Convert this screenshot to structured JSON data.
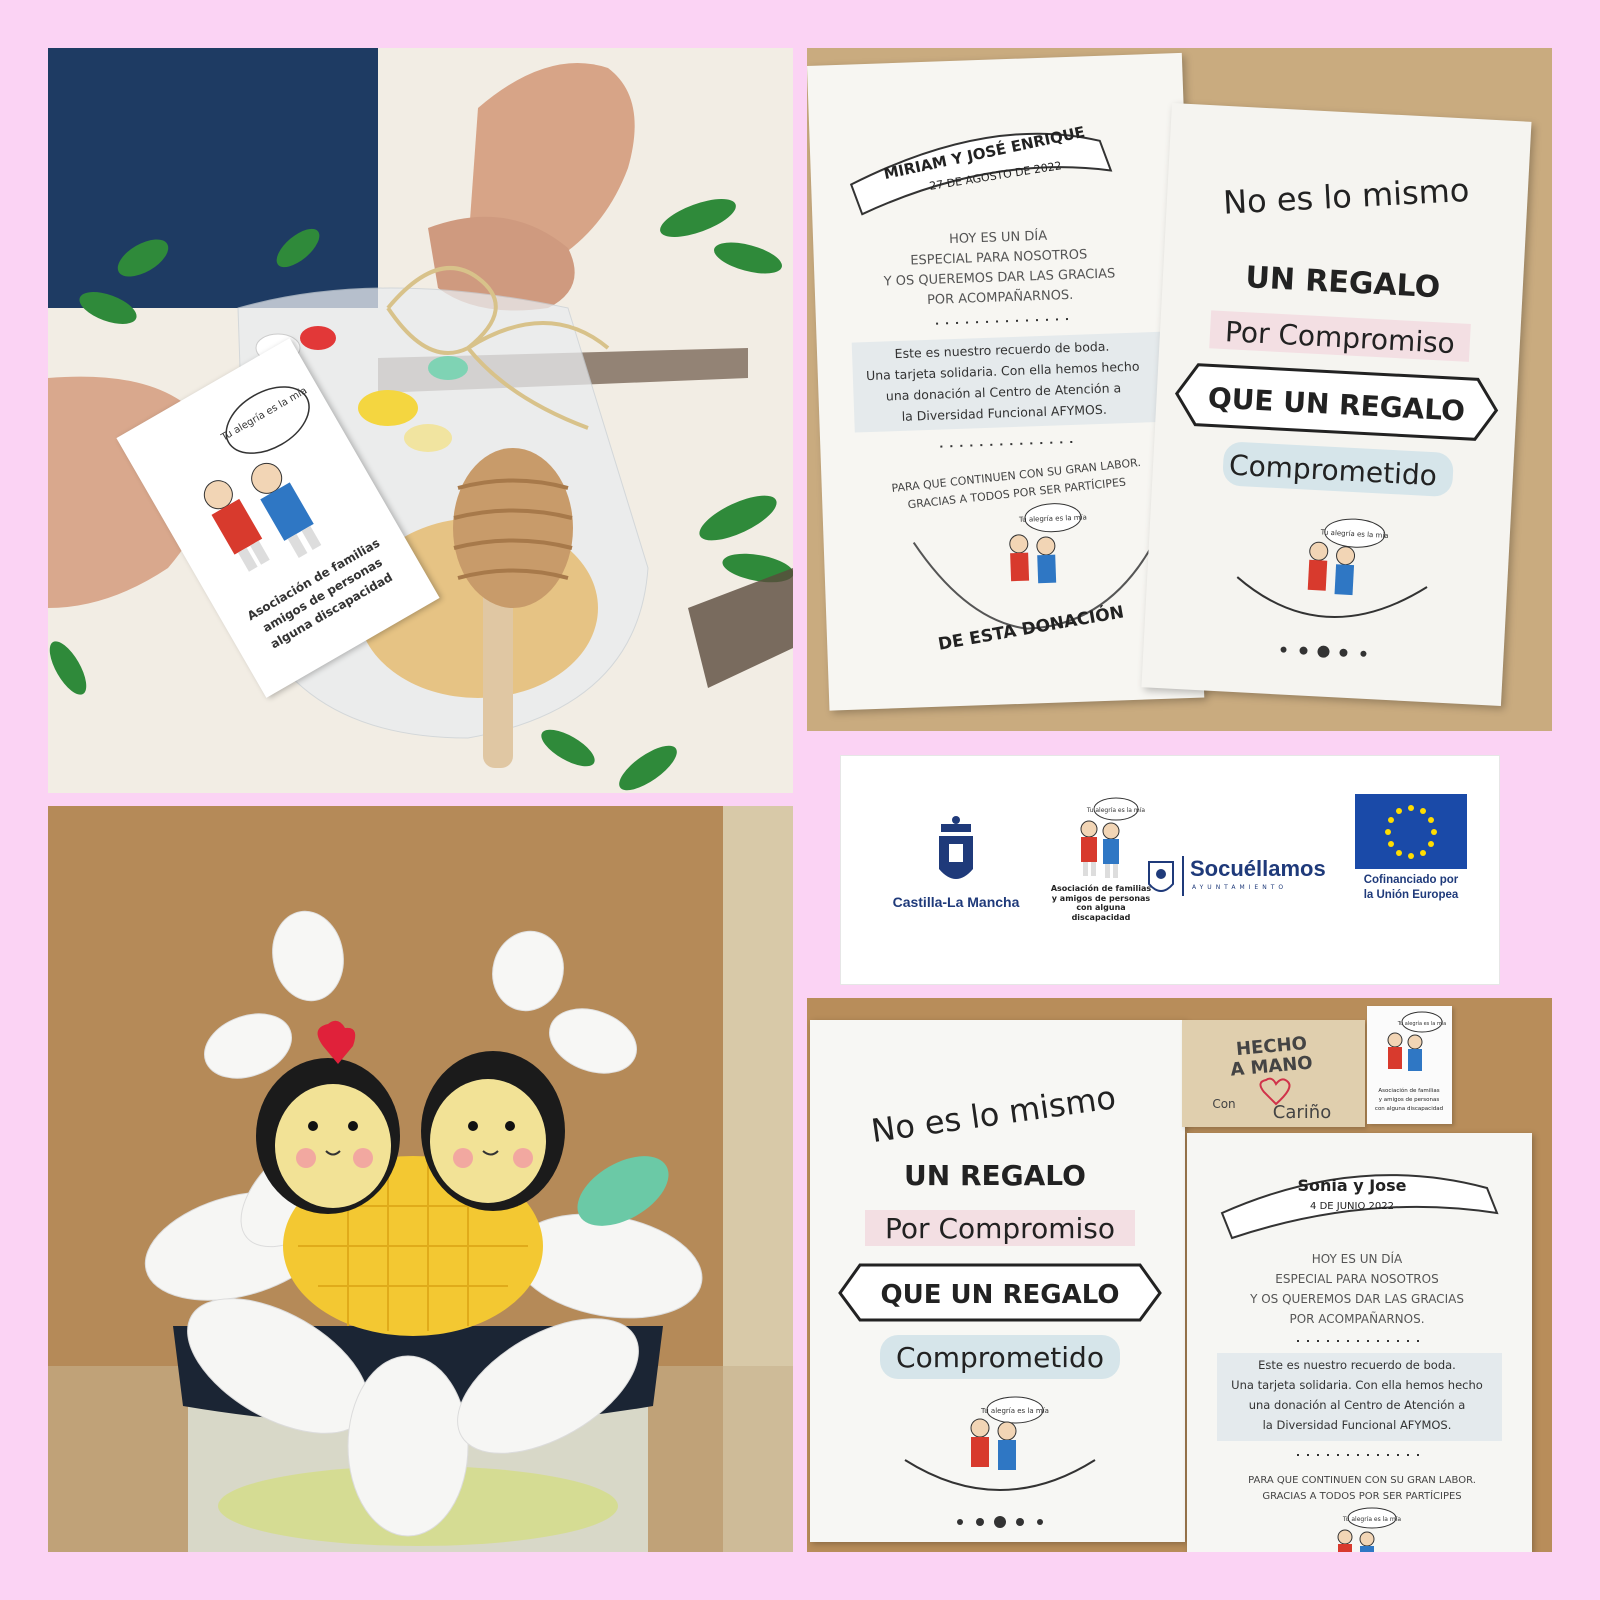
{
  "colors": {
    "background": "#fbd3f4",
    "eu_blue": "#1a4aa8",
    "eu_star": "#ffdd00",
    "socuellamos_blue": "#1f3a7a"
  },
  "photo_honey_gift": {
    "tag_bubble": "Tu alegría es la mía",
    "tag_lines": [
      "Asociación de familias",
      "amigos de personas",
      "alguna discapacidad"
    ]
  },
  "card_miriam": {
    "names": "MIRIAM Y JOSÉ ENRIQUE",
    "date": "27 DE AGOSTO DE 2022",
    "intro": [
      "HOY ES UN DÍA",
      "ESPECIAL PARA NOSOTROS",
      "Y OS QUEREMOS DAR LAS GRACIAS",
      "POR ACOMPAÑARNOS."
    ],
    "body": [
      "Este es nuestro recuerdo de boda.",
      "Una tarjeta solidaria. Con ella hemos hecho",
      "una donación al Centro de Atención a",
      "la Diversidad Funcional AFYMOS."
    ],
    "closing": [
      "PARA QUE CONTINUEN CON SU GRAN LABOR.",
      "GRACIAS A TODOS POR SER PARTÍCIPES"
    ],
    "footer": "DE ESTA DONACIÓN",
    "bubble": "Tu alegría es la mía"
  },
  "card_regalo": {
    "line1": "No es lo mismo",
    "line2": "UN REGALO",
    "line3": "Por Compromiso",
    "line4": "QUE UN REGALO",
    "line5": "Comprometido",
    "bubble": "Tu alegría es la mía"
  },
  "logos": {
    "clm": "Castilla-La Mancha",
    "afymos_lines": [
      "Asociación de familias",
      "y amigos de personas",
      "con alguna discapacidad"
    ],
    "afymos_bubble": "Tu alegría es la mía",
    "socuellamos": "Socuéllamos",
    "socuellamos_sub": "AYUNTAMIENTO",
    "eu_lines": [
      "Cofinanciado por",
      "la Unión Europea"
    ]
  },
  "card_regalo2": {
    "line1": "No es lo mismo",
    "line2": "UN REGALO",
    "line3": "Por Compromiso",
    "line4": "QUE UN REGALO",
    "line5": "Comprometido",
    "bubble": "Tu alegría es la mía"
  },
  "kraft_tag": {
    "line1": "HECHO",
    "line2": "A MANO",
    "line3": "Con",
    "line4": "Cariño"
  },
  "small_tag": {
    "bubble": "Tu alegría es la mía",
    "lines": [
      "Asociación de familias",
      "y amigos de personas",
      "con alguna discapacidad"
    ]
  },
  "card_sonia": {
    "names": "Sonia y Jose",
    "date": "4 DE JUNIO 2022",
    "intro": [
      "HOY ES UN DÍA",
      "ESPECIAL PARA NOSOTROS",
      "Y OS QUEREMOS DAR LAS GRACIAS",
      "POR ACOMPAÑARNOS."
    ],
    "body": [
      "Este es nuestro recuerdo de boda.",
      "Una tarjeta solidaria. Con ella hemos hecho",
      "una donación al Centro de Atención a",
      "la Diversidad Funcional AFYMOS."
    ],
    "closing": [
      "PARA QUE CONTINUEN CON SU GRAN LABOR.",
      "GRACIAS A TODOS POR SER PARTÍCIPES"
    ],
    "bubble": "Tu alegría es la mía"
  }
}
